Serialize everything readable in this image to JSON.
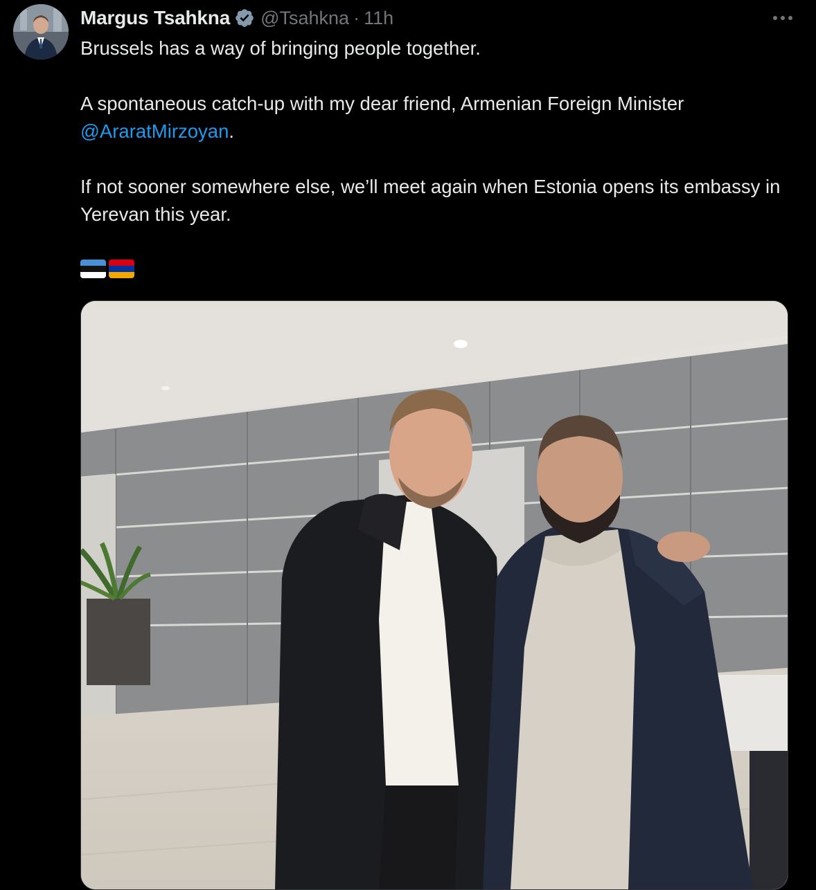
{
  "tweet": {
    "author": {
      "display_name": "Margus Tsahkna",
      "handle": "@Tsahkna",
      "verified_icon": "verified-badge-icon"
    },
    "separator": "·",
    "timestamp": "11h",
    "more_icon": "more-horizontal-icon",
    "text": {
      "line1": "Brussels has a way of bringing people together.",
      "line2": "A spontaneous catch-up with my dear friend, Armenian Foreign Minister",
      "mention": "@AraratMirzoyan",
      "mention_suffix": ".",
      "line3": "If not sooner somewhere else, we’ll meet again when Estonia opens its embassy in Yerevan this year."
    },
    "flags": [
      "estonia-flag-emoji",
      "armenia-flag-emoji"
    ],
    "media": {
      "type": "photo"
    }
  },
  "colors": {
    "background": "#000000",
    "text": "#e7e9ea",
    "secondary": "#71767b",
    "link": "#1d9bf0",
    "verified": "#829aab"
  }
}
